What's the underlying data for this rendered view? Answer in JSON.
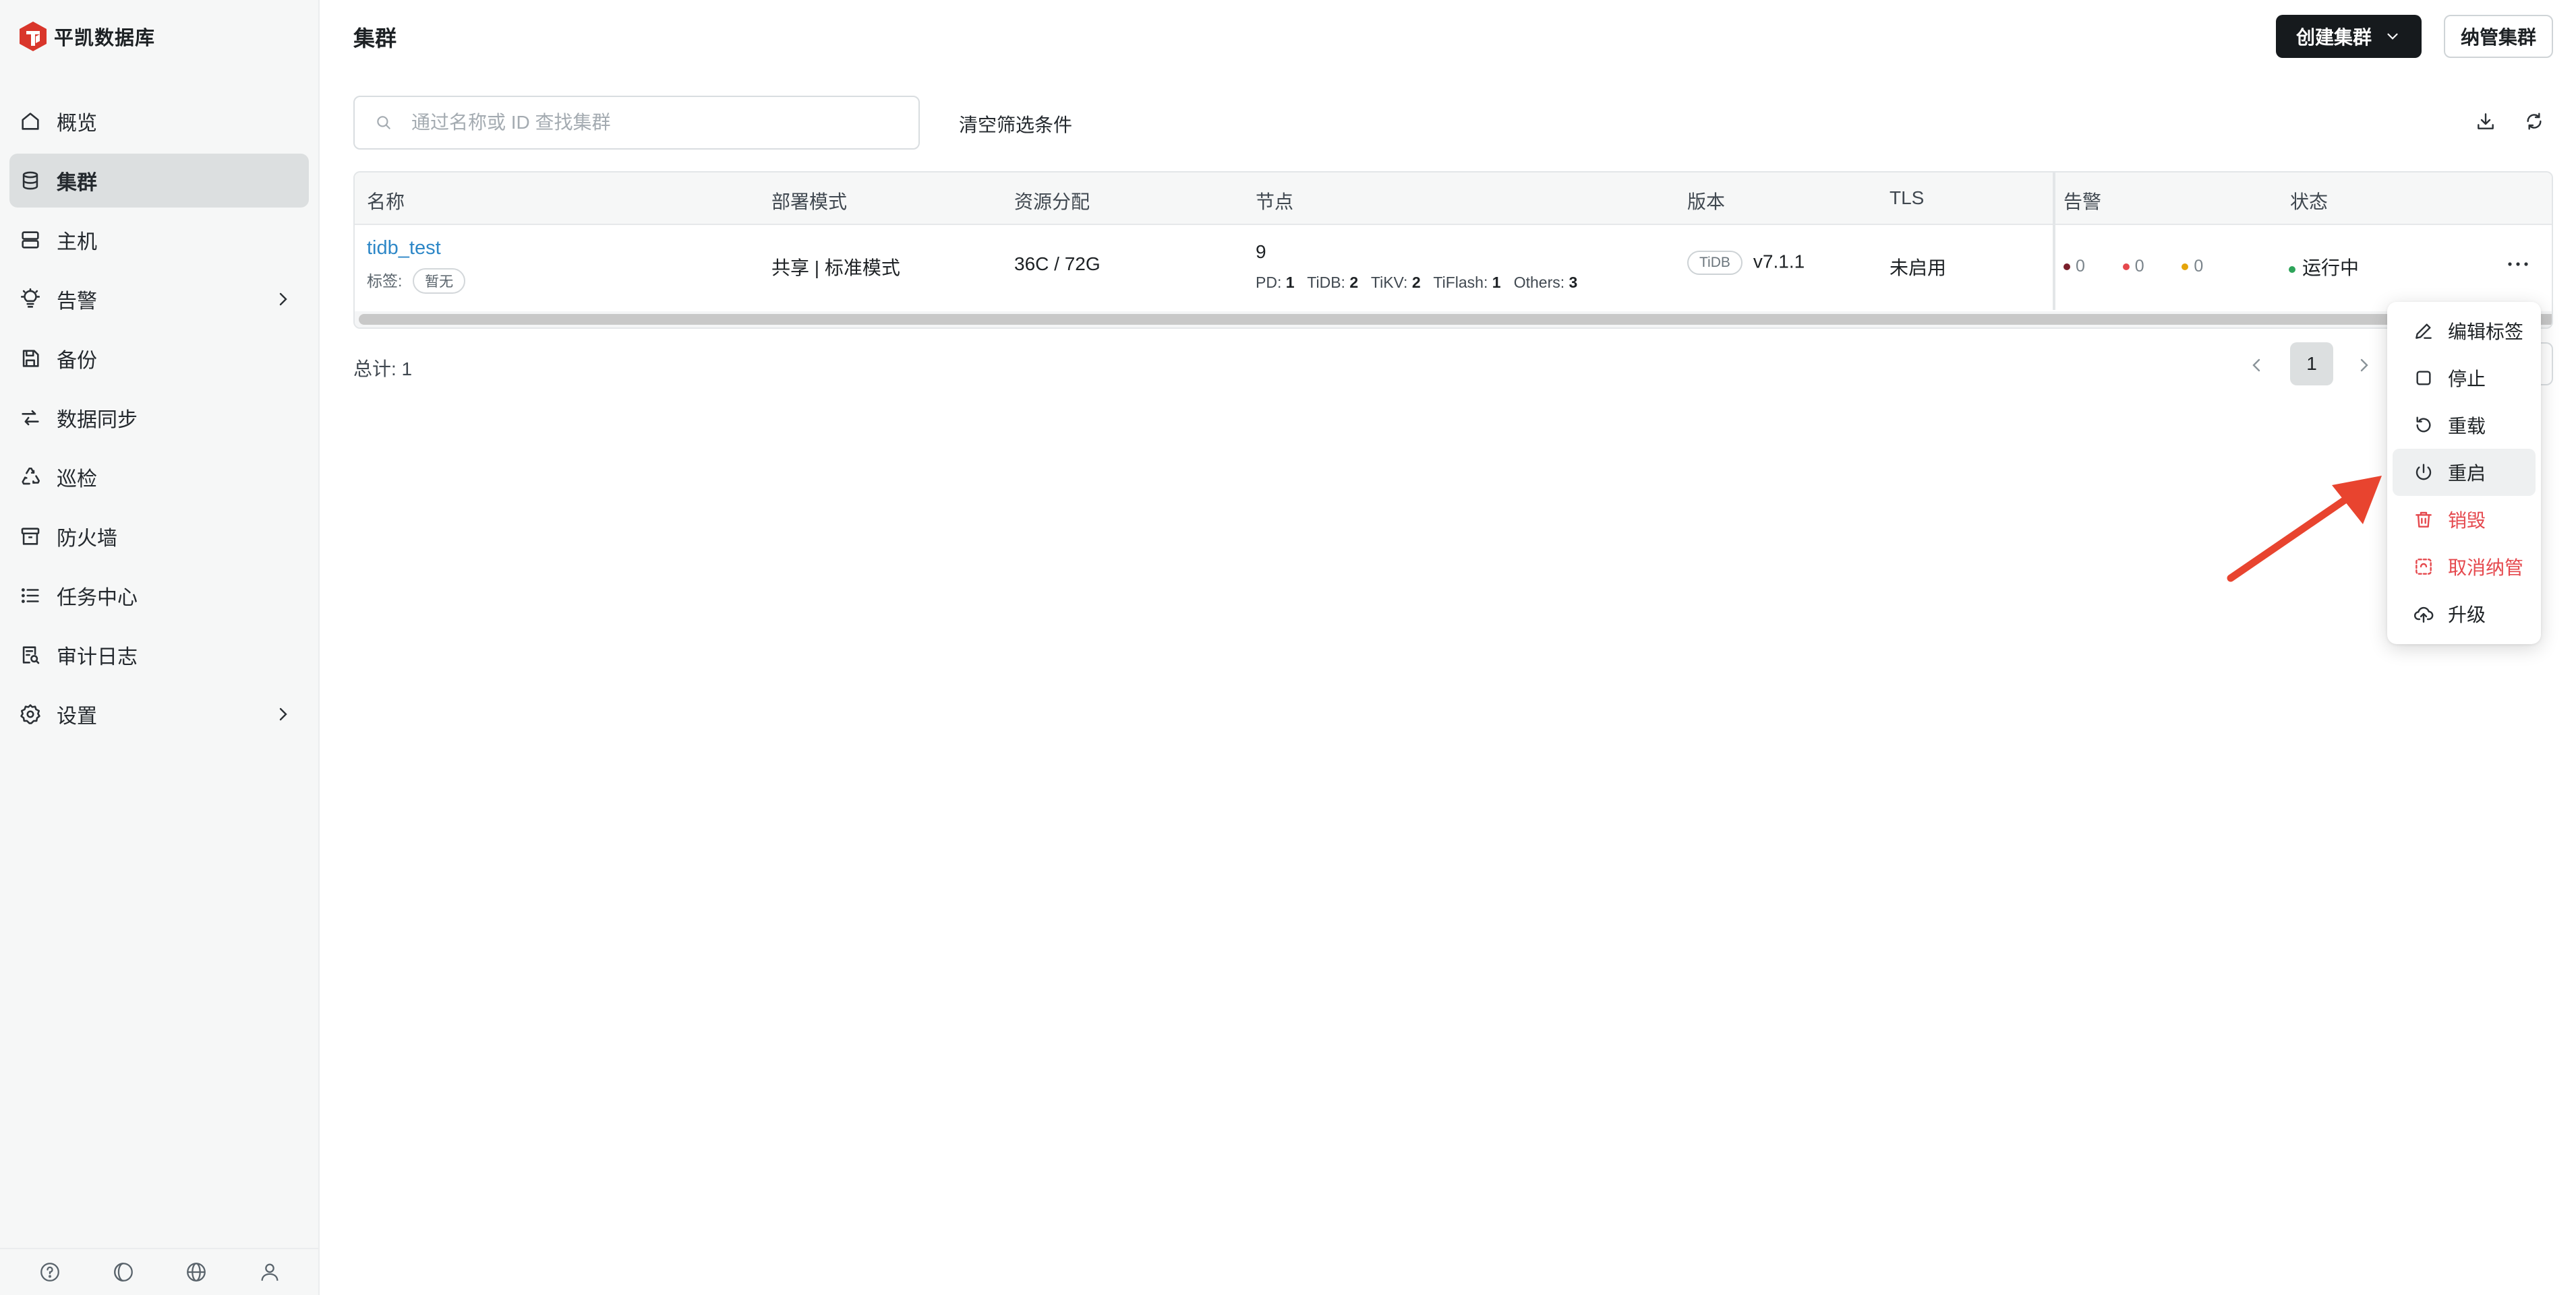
{
  "brand": {
    "name": "平凯数据库",
    "color": "#d9362b"
  },
  "sidebar": {
    "items": [
      {
        "label": "概览",
        "icon": "home-icon"
      },
      {
        "label": "集群",
        "icon": "database-icon",
        "active": true
      },
      {
        "label": "主机",
        "icon": "server-icon"
      },
      {
        "label": "告警",
        "icon": "bulb-icon",
        "has_submenu": true
      },
      {
        "label": "备份",
        "icon": "save-icon"
      },
      {
        "label": "数据同步",
        "icon": "sync-arrows-icon"
      },
      {
        "label": "巡检",
        "icon": "recycle-icon"
      },
      {
        "label": "防火墙",
        "icon": "archive-icon"
      },
      {
        "label": "任务中心",
        "icon": "list-icon"
      },
      {
        "label": "审计日志",
        "icon": "audit-log-icon"
      },
      {
        "label": "设置",
        "icon": "gear-icon",
        "has_submenu": true
      }
    ],
    "footer_icons": [
      "help-icon",
      "theme-icon",
      "globe-icon",
      "user-icon"
    ]
  },
  "header": {
    "title": "集群",
    "create_button": "创建集群",
    "manage_button": "纳管集群"
  },
  "toolbar": {
    "search_placeholder": "通过名称或 ID 查找集群",
    "search_value": "",
    "clear_filters": "清空筛选条件"
  },
  "table": {
    "columns": [
      "名称",
      "部署模式",
      "资源分配",
      "节点",
      "版本",
      "TLS",
      "告警",
      "状态"
    ],
    "rows": [
      {
        "name": "tidb_test",
        "tag_label": "标签:",
        "tag_value": "暂无",
        "deploy_mode": "共享 | 标准模式",
        "resources": "36C / 72G",
        "node_total": "9",
        "nodes": [
          {
            "k": "PD:",
            "v": "1"
          },
          {
            "k": "TiDB:",
            "v": "2"
          },
          {
            "k": "TiKV:",
            "v": "2"
          },
          {
            "k": "TiFlash:",
            "v": "1"
          },
          {
            "k": "Others:",
            "v": "3"
          }
        ],
        "version_type": "TiDB",
        "version": "v7.1.1",
        "tls": "未启用",
        "alerts": [
          {
            "count": "0",
            "color": "#7a1f2b"
          },
          {
            "count": "0",
            "color": "#e5484d"
          },
          {
            "count": "0",
            "color": "#e5a50a"
          }
        ],
        "status": "运行中",
        "status_color": "#2ea45a"
      }
    ]
  },
  "pagination": {
    "total": "总计: 1",
    "current_page": "1"
  },
  "row_menu": {
    "items": [
      {
        "label": "编辑标签",
        "icon": "pencil-icon"
      },
      {
        "label": "停止",
        "icon": "stop-square-icon"
      },
      {
        "label": "重载",
        "icon": "reload-icon"
      },
      {
        "label": "重启",
        "icon": "power-icon",
        "hovered": true
      },
      {
        "label": "销毁",
        "icon": "trash-icon",
        "danger": true
      },
      {
        "label": "取消纳管",
        "icon": "unmanage-icon",
        "danger": true
      },
      {
        "label": "升级",
        "icon": "cloud-upload-icon"
      }
    ]
  },
  "annotation_arrow_color": "#e8442f"
}
